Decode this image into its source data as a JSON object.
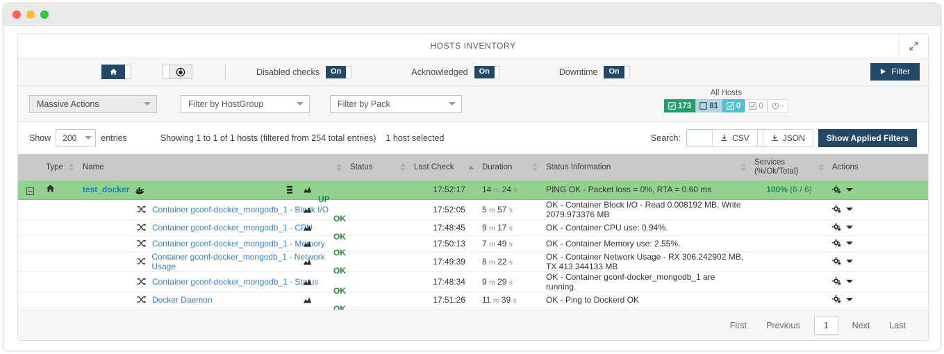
{
  "window": {
    "dots": [
      "close",
      "minimize",
      "maximize"
    ]
  },
  "panel": {
    "title": "HOSTS INVENTORY",
    "collapse_icon": "compress-arrows-icon"
  },
  "toolbar": {
    "view_buttons": [
      {
        "name": "home-view",
        "icon": "home-icon",
        "active": true
      },
      {
        "name": "target-view",
        "icon": "target-icon",
        "active": false
      }
    ],
    "toggles": [
      {
        "label": "Disabled checks",
        "value": "On"
      },
      {
        "label": "Acknowledged",
        "value": "On"
      },
      {
        "label": "Downtime",
        "value": "On"
      }
    ],
    "filter_button": {
      "label": "Filter",
      "icon": "play-icon"
    }
  },
  "filters": {
    "massive_actions": "Massive Actions",
    "hostgroup": "Filter by HostGroup",
    "pack": "Filter by Pack",
    "all_hosts": {
      "label": "All Hosts",
      "badges": [
        {
          "icon": "check-square-icon",
          "value": "173",
          "color": "#22a06b",
          "style": "b-green"
        },
        {
          "icon": "square-icon",
          "value": "81",
          "color": "#b6d4e3",
          "style": "b-blue"
        },
        {
          "icon": "check-square-icon",
          "value": "0",
          "color": "#4cc2d4",
          "style": "b-cyan"
        },
        {
          "icon": "check-square-icon",
          "value": "0",
          "color": "#ffffff",
          "style": "b-white"
        },
        {
          "icon": "clock-icon",
          "value": "-",
          "color": "#ffffff",
          "style": "b-clock"
        }
      ]
    }
  },
  "show_row": {
    "show_label": "Show",
    "entries_value": "200",
    "entries_label": "entries",
    "showing_text": "Showing 1 to 1 of 1 hosts (filtered from 254 total entries)",
    "selected_text": "1 host selected",
    "search_label": "Search:",
    "search_value": "",
    "search_placeholder": "",
    "csv_label": "CSV",
    "json_label": "JSON",
    "show_applied_filters": "Show Applied Filters"
  },
  "table": {
    "columns": [
      {
        "label": "Type",
        "sortable": true,
        "sorted": "none"
      },
      {
        "label": "Name",
        "sortable": true,
        "sorted": "none"
      },
      {
        "label": "Status",
        "sortable": true,
        "sorted": "none"
      },
      {
        "label": "Last Check",
        "sortable": true,
        "sorted": "asc"
      },
      {
        "label": "Duration",
        "sortable": true,
        "sorted": "none"
      },
      {
        "label": "Status Information",
        "sortable": true,
        "sorted": "none"
      },
      {
        "label": "Services (%/Ok/Total)",
        "sortable": true,
        "sorted": "none"
      },
      {
        "label": "Actions",
        "sortable": false,
        "sorted": "none"
      }
    ],
    "host": {
      "name": "test_docker",
      "type_icon": "home-icon",
      "badge_icon": "docker-icon",
      "extra_icons": [
        "server-icon",
        "chart-icon"
      ],
      "status": "UP",
      "last_check": "17:52:17",
      "duration_value": "14",
      "duration_unit_1": "m",
      "duration_value_2": "24",
      "duration_unit_2": "s",
      "status_information": "PING OK - Packet loss = 0%, RTA = 0.60 ms",
      "services_pct": "100%",
      "services_count": "(6 / 6)",
      "actions_icon": "gear-icon"
    },
    "services": [
      {
        "name": "Container gconf-docker_mongodb_1 - Block I/O",
        "icon": "shuffle-icon",
        "chart_icon": "chart-icon",
        "status": "OK",
        "last_check": "17:52:05",
        "duration_value": "5",
        "duration_unit_1": "m",
        "duration_value_2": "57",
        "duration_unit_2": "s",
        "status_information": "OK - Container Block I/O - Read 0.008192 MB, Write 2079.973376 MB"
      },
      {
        "name": "Container gconf-docker_mongodb_1 - CPU",
        "icon": "shuffle-icon",
        "chart_icon": "chart-icon",
        "status": "OK",
        "last_check": "17:48:45",
        "duration_value": "9",
        "duration_unit_1": "m",
        "duration_value_2": "17",
        "duration_unit_2": "s",
        "status_information": "OK - Container CPU use: 0.94%."
      },
      {
        "name": "Container gconf-docker_mongodb_1 - Memory",
        "icon": "shuffle-icon",
        "chart_icon": "chart-icon",
        "status": "OK",
        "last_check": "17:50:13",
        "duration_value": "7",
        "duration_unit_1": "m",
        "duration_value_2": "49",
        "duration_unit_2": "s",
        "status_information": "OK - Container Memory use: 2.55%."
      },
      {
        "name": "Container gconf-docker_mongodb_1 - Network Usage",
        "icon": "shuffle-icon",
        "chart_icon": "chart-icon",
        "status": "OK",
        "last_check": "17:49:39",
        "duration_value": "8",
        "duration_unit_1": "m",
        "duration_value_2": "22",
        "duration_unit_2": "s",
        "status_information": "OK - Container Network Usage - RX 306.242902 MB, TX 413.344133 MB"
      },
      {
        "name": "Container gconf-docker_mongodb_1 - Status",
        "icon": "shuffle-icon",
        "chart_icon": "chart-icon",
        "status": "OK",
        "last_check": "17:48:34",
        "duration_value": "9",
        "duration_unit_1": "m",
        "duration_value_2": "29",
        "duration_unit_2": "s",
        "status_information": "OK - Container gconf-docker_mongodb_1 are running."
      },
      {
        "name": "Docker Daemon",
        "icon": "shuffle-icon",
        "chart_icon": "chart-icon",
        "status": "OK",
        "last_check": "17:51:26",
        "duration_value": "11",
        "duration_unit_1": "m",
        "duration_value_2": "39",
        "duration_unit_2": "s",
        "status_information": "OK - Ping to Dockerd OK"
      }
    ]
  },
  "pagination": {
    "first": "First",
    "previous": "Previous",
    "current": "1",
    "next": "Next",
    "last": "Last"
  },
  "colors": {
    "accent_dark": "#234868",
    "host_row_green": "#92d28f",
    "link_blue": "#3a7fbf",
    "status_green": "#2b8a3e"
  }
}
